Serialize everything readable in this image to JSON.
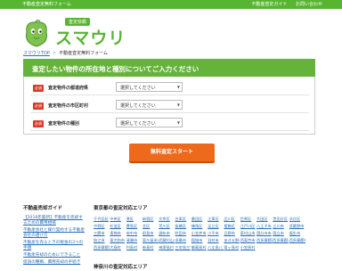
{
  "topbar": {
    "tagline": "不動産査定無料フォーム",
    "links": [
      "不動産査定ガイド",
      "お問い合わせ"
    ]
  },
  "logo": {
    "badge": "査定依頼",
    "text": "スマウリ"
  },
  "breadcrumb": {
    "home": "スマウリTOP",
    "current": "不動産査定無料フォーム"
  },
  "form": {
    "title": "査定したい物件の所在地と種別についてご入力ください",
    "rows": [
      {
        "required": "必須",
        "label": "査定物件の都道府県",
        "placeholder": "選択してください"
      },
      {
        "required": "必須",
        "label": "査定物件の市区町村",
        "placeholder": "選択してください"
      },
      {
        "required": "必須",
        "label": "査定物件の種別",
        "placeholder": "選択してください"
      }
    ],
    "cta": "無料査定スタート"
  },
  "guide": {
    "title": "不動産売却ガイド",
    "items": [
      "【2018年最新】不動産を売却するための費用相場",
      "不動産会社と媒介契約する不動産会社の選び方",
      "不動産を売るときの税金の3つの手順",
      "不動産売却のためにできること",
      "提訴の種類、費用売却の手続き"
    ]
  },
  "tokyo": {
    "title": "東京都の査定対応エリア",
    "cities": [
      "千代田区",
      "中央区",
      "港区",
      "新宿区",
      "文京区",
      "台東区",
      "墨田区",
      "江東区",
      "品川区",
      "目黒区",
      "大田区",
      "世田谷区",
      "渋谷区",
      "中野区",
      "杉並区",
      "豊島区",
      "北区",
      "荒川区",
      "板橋区",
      "練馬区",
      "足立区",
      "葛飾区",
      "江戸川区",
      "八王子市",
      "立川市",
      "武蔵野市",
      "三鷹市",
      "青梅市",
      "府中市",
      "昭島市",
      "調布市",
      "町田市",
      "小金井市",
      "小平市",
      "日野市",
      "東村山市",
      "国分寺市",
      "国立市",
      "福生市",
      "狛江市",
      "東大和市",
      "清瀬市",
      "東久留米市",
      "武蔵村山市",
      "多摩市",
      "稲城市",
      "羽村市",
      "あきる野市",
      "西東京市",
      "西多摩郡瑞穂町",
      "西多摩郡日の出町",
      "西多摩郡檜原村",
      "西多摩郡奥多摩町",
      "大島町",
      "利島村",
      "新島村",
      "神津島村",
      "三宅島三宅村",
      "御蔵島村",
      "八丈島八丈町",
      "青ヶ島村",
      "小笠原村"
    ]
  },
  "kanagawa": {
    "title": "神奈川の査定対応エリア"
  }
}
